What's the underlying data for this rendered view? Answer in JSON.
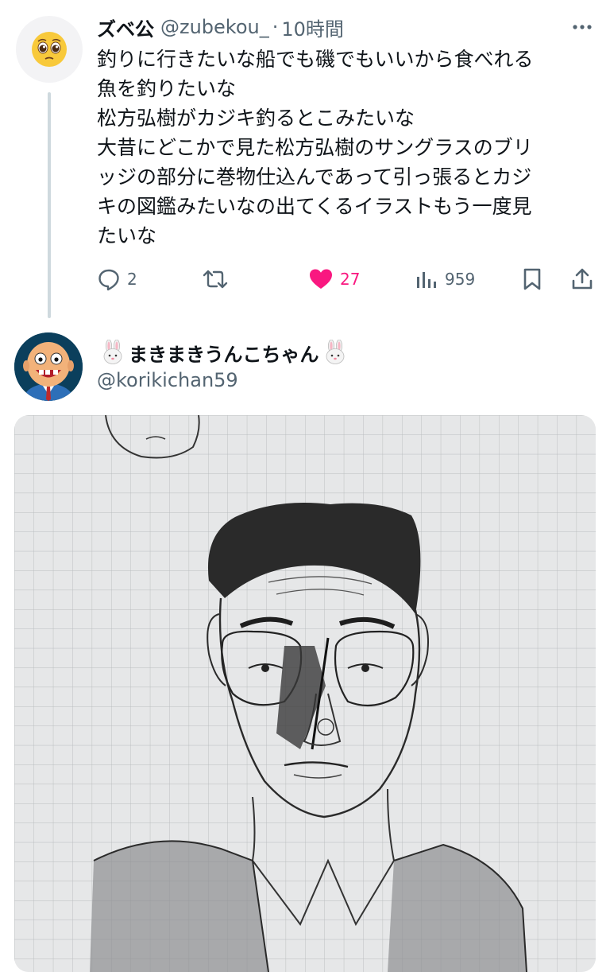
{
  "tweet1": {
    "display_name": "ズベ公",
    "handle": "@zubekou_",
    "separator": "·",
    "time": "10時間",
    "text_lines": [
      "釣りに行きたいな船でも磯でもいいから食べれる",
      "魚を釣りたいな",
      "松方弘樹がカジキ釣るとこみたいな",
      "大昔にどこかで見た松方弘樹のサングラスのブリ",
      "ッジの部分に巻物仕込んであって引っ張るとカジ",
      "キの図鑑みたいなの出てくるイラストもう一度見",
      "たいな"
    ],
    "replies": "2",
    "likes": "27",
    "views": "959",
    "icons": {
      "avatar": "pleading-face-emoji",
      "more": "more-dots-icon",
      "reply": "reply-icon",
      "retweet": "retweet-icon",
      "like": "heart-filled-icon",
      "views": "views-bar-icon",
      "bookmark": "bookmark-icon",
      "share": "share-icon"
    },
    "colors": {
      "like": "#f91880",
      "muted": "#536471",
      "thread_line": "#cfd9de"
    }
  },
  "tweet2": {
    "display_name": "まきまきうんこちゃん",
    "handle": "@korikichan59",
    "icons": {
      "avatar": "cartoon-bald-man-avatar",
      "name_emoji": "rabbit-face-emoji"
    },
    "media": {
      "type": "pencil-sketch-on-grid-paper"
    }
  }
}
